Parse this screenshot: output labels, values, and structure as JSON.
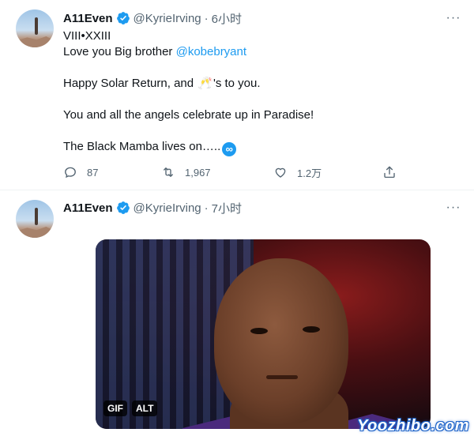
{
  "tweets": [
    {
      "author_name": "A11Even",
      "handle": "@KyrieIrving",
      "separator": "·",
      "time": "6小时",
      "lines": {
        "l1": "VIII•XXIII",
        "l2_prefix": "Love you Big brother ",
        "l2_mention": "@kobebryant",
        "l3_prefix": "Happy Solar Return, and ",
        "l3_emoji": "🥂",
        "l3_suffix": "'s to you.",
        "l4": "You and all the angels celebrate up in Paradise!",
        "l5": "The Black Mamba lives on…..",
        "l5_emoji": "∞"
      },
      "actions": {
        "replies": "87",
        "retweets": "1,967",
        "likes": "1.2万",
        "share": ""
      },
      "more_icon": "more-dots-icon"
    },
    {
      "author_name": "A11Even",
      "handle": "@KyrieIrving",
      "separator": "·",
      "time": "7小时",
      "media": {
        "badge_gif": "GIF",
        "badge_alt": "ALT"
      },
      "more_icon": "more-dots-icon"
    }
  ],
  "watermark": "Yoozhibo.com",
  "colors": {
    "accent": "#1d9bf0",
    "text": "#0f1419",
    "secondary": "#536471",
    "divider": "#eff3f4"
  }
}
